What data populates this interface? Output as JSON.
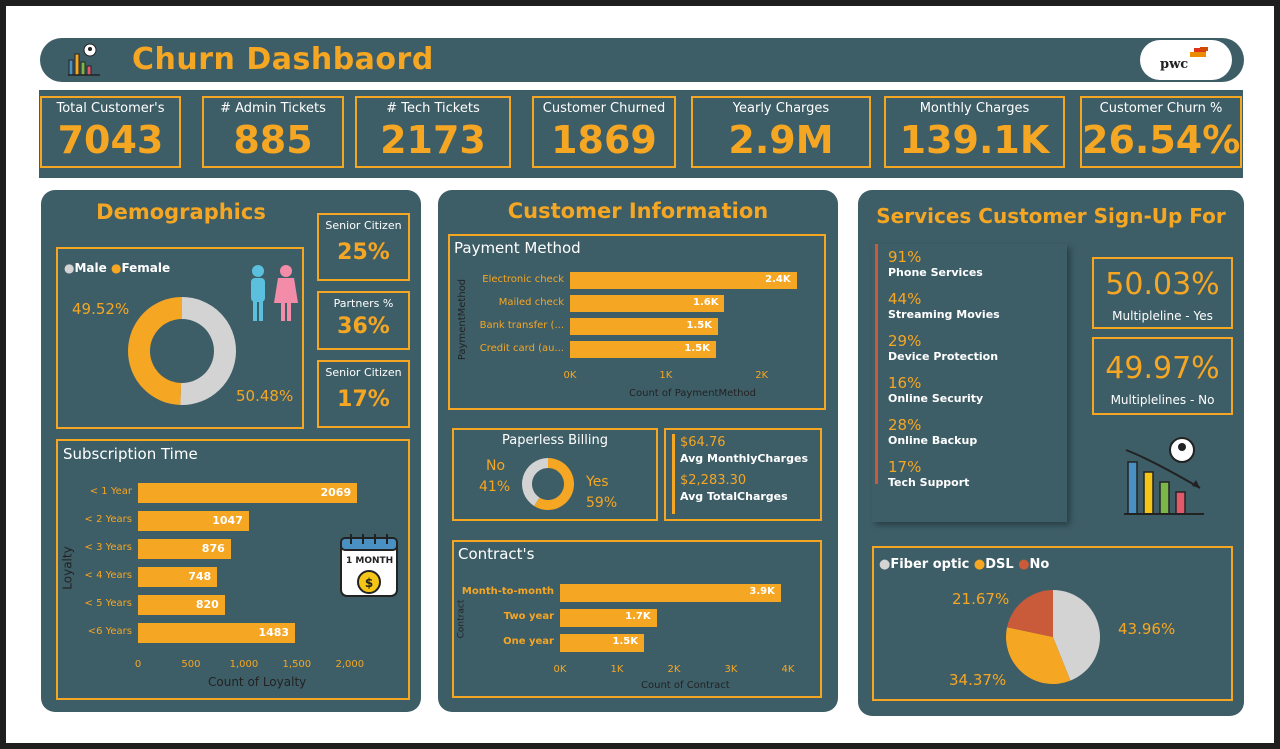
{
  "header": {
    "title": "Churn Dashbaord",
    "logo_text": "pwc"
  },
  "kpis": [
    {
      "label": "Total Customer's",
      "value": "7043"
    },
    {
      "label": "# Admin Tickets",
      "value": "885"
    },
    {
      "label": "# Tech Tickets",
      "value": "2173"
    },
    {
      "label": "Customer Churned",
      "value": "1869"
    },
    {
      "label": "Yearly Charges",
      "value": "2.9M"
    },
    {
      "label": "Monthly Charges",
      "value": "139.1K"
    },
    {
      "label": "Customer Churn %",
      "value": "26.54%"
    }
  ],
  "demographics": {
    "title": "Demographics",
    "gender": {
      "legend_male": "Male",
      "legend_female": "Female",
      "female_pct": "49.52%",
      "male_pct": "50.48%"
    },
    "senior_citizen": {
      "label": "Senior Citizen",
      "value": "25%"
    },
    "partners": {
      "label": "Partners %",
      "value": "36%"
    },
    "senior_citizen_2": {
      "label": "Senior Citizen",
      "value": "17%"
    },
    "subscription": {
      "title": "Subscription Time",
      "ylabel": "Loyalty",
      "xlabel": "Count of Loyalty",
      "calendar_text": "1 MONTH"
    }
  },
  "customer_info": {
    "title": "Customer Information",
    "payment": {
      "title": "Payment Method",
      "ylabel": "PaymentMethod",
      "xlabel": "Count of PaymentMethod"
    },
    "paperless": {
      "title": "Paperless Billing",
      "no_label": "No",
      "no_pct": "41%",
      "yes_label": "Yes",
      "yes_pct": "59%"
    },
    "avgs": {
      "monthly_value": "$64.76",
      "monthly_label": "Avg MonthlyCharges",
      "total_value": "$2,283.30",
      "total_label": "Avg TotalCharges"
    },
    "contract": {
      "title": "Contract's",
      "ylabel": "Contract",
      "xlabel": "Count of Contract"
    }
  },
  "services": {
    "title": "Services Customer Sign-Up For",
    "items": [
      {
        "pct": "91%",
        "label": "Phone Services"
      },
      {
        "pct": "44%",
        "label": "Streaming Movies"
      },
      {
        "pct": "29%",
        "label": "Device Protection"
      },
      {
        "pct": "16%",
        "label": "Online Security"
      },
      {
        "pct": "28%",
        "label": "Online Backup"
      },
      {
        "pct": "17%",
        "label": "Tech Support"
      }
    ],
    "multi_yes": {
      "value": "50.03%",
      "label": "Multipleline - Yes"
    },
    "multi_no": {
      "value": "49.97%",
      "label": "Multiplelines - No"
    },
    "internet": {
      "legend": [
        "Fiber optic",
        "DSL",
        "No"
      ],
      "pct_no": "21.67%",
      "pct_fiber": "43.96%",
      "pct_dsl": "34.37%"
    }
  },
  "chart_data": [
    {
      "type": "bar",
      "title": "Subscription Time",
      "categories": [
        "< 1 Year",
        "< 2 Years",
        "< 3 Years",
        "< 4 Years",
        "< 5 Years",
        "<6 Years"
      ],
      "values": [
        2069,
        1047,
        876,
        748,
        820,
        1483
      ],
      "xlabel": "Count of Loyalty",
      "ylabel": "Loyalty",
      "xticks": [
        "0",
        "500",
        "1,000",
        "1,500",
        "2,000"
      ],
      "xlim": [
        0,
        2200
      ]
    },
    {
      "type": "bar",
      "title": "Payment Method",
      "categories": [
        "Electronic check",
        "Mailed check",
        "Bank transfer (...",
        "Credit card (au..."
      ],
      "values": [
        2365,
        1612,
        1544,
        1522
      ],
      "value_labels": [
        "2.4K",
        "1.6K",
        "1.5K",
        "1.5K"
      ],
      "xlabel": "Count of PaymentMethod",
      "ylabel": "PaymentMethod",
      "xticks": [
        "0K",
        "1K",
        "2K"
      ],
      "xlim": [
        0,
        2400
      ]
    },
    {
      "type": "bar",
      "title": "Contract's",
      "categories": [
        "Month-to-month",
        "Two year",
        "One year"
      ],
      "values": [
        3875,
        1695,
        1473
      ],
      "value_labels": [
        "3.9K",
        "1.7K",
        "1.5K"
      ],
      "xlabel": "Count of Contract",
      "ylabel": "Contract",
      "xticks": [
        "0K",
        "1K",
        "2K",
        "3K",
        "4K"
      ],
      "xlim": [
        0,
        4000
      ]
    },
    {
      "type": "pie",
      "title": "",
      "labels": [
        "Male",
        "Female"
      ],
      "values": [
        50.48,
        49.52
      ],
      "colors": [
        "#d3d3d3",
        "#f5a623"
      ]
    },
    {
      "type": "pie",
      "title": "Paperless Billing",
      "labels": [
        "Yes",
        "No"
      ],
      "values": [
        59,
        41
      ],
      "colors": [
        "#f5a623",
        "#d3d3d3"
      ]
    },
    {
      "type": "pie",
      "title": "",
      "labels": [
        "Fiber optic",
        "DSL",
        "No"
      ],
      "values": [
        43.96,
        34.37,
        21.67
      ],
      "colors": [
        "#d3d3d3",
        "#f5a623",
        "#c95a3a"
      ]
    }
  ],
  "colors": {
    "teal": "#3e5e67",
    "orange": "#f5a623",
    "grey": "#d3d3d3",
    "red": "#c95a3a"
  }
}
